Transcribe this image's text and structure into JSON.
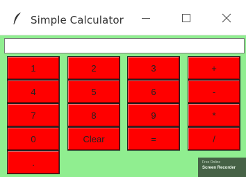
{
  "window": {
    "title": "Simple Calculator",
    "icon": "feather-icon"
  },
  "display": {
    "value": ""
  },
  "keys": [
    [
      "1",
      "2",
      "3",
      "+"
    ],
    [
      "4",
      "5",
      "6",
      "-"
    ],
    [
      "7",
      "8",
      "9",
      "*"
    ],
    [
      "0",
      "Clear",
      "=",
      "/"
    ],
    [
      "."
    ]
  ],
  "watermark": {
    "line1": "Free Online",
    "line2": "Screen Recorder"
  },
  "colors": {
    "key_bg": "#ff0000",
    "panel_bg": "#90ee90"
  }
}
